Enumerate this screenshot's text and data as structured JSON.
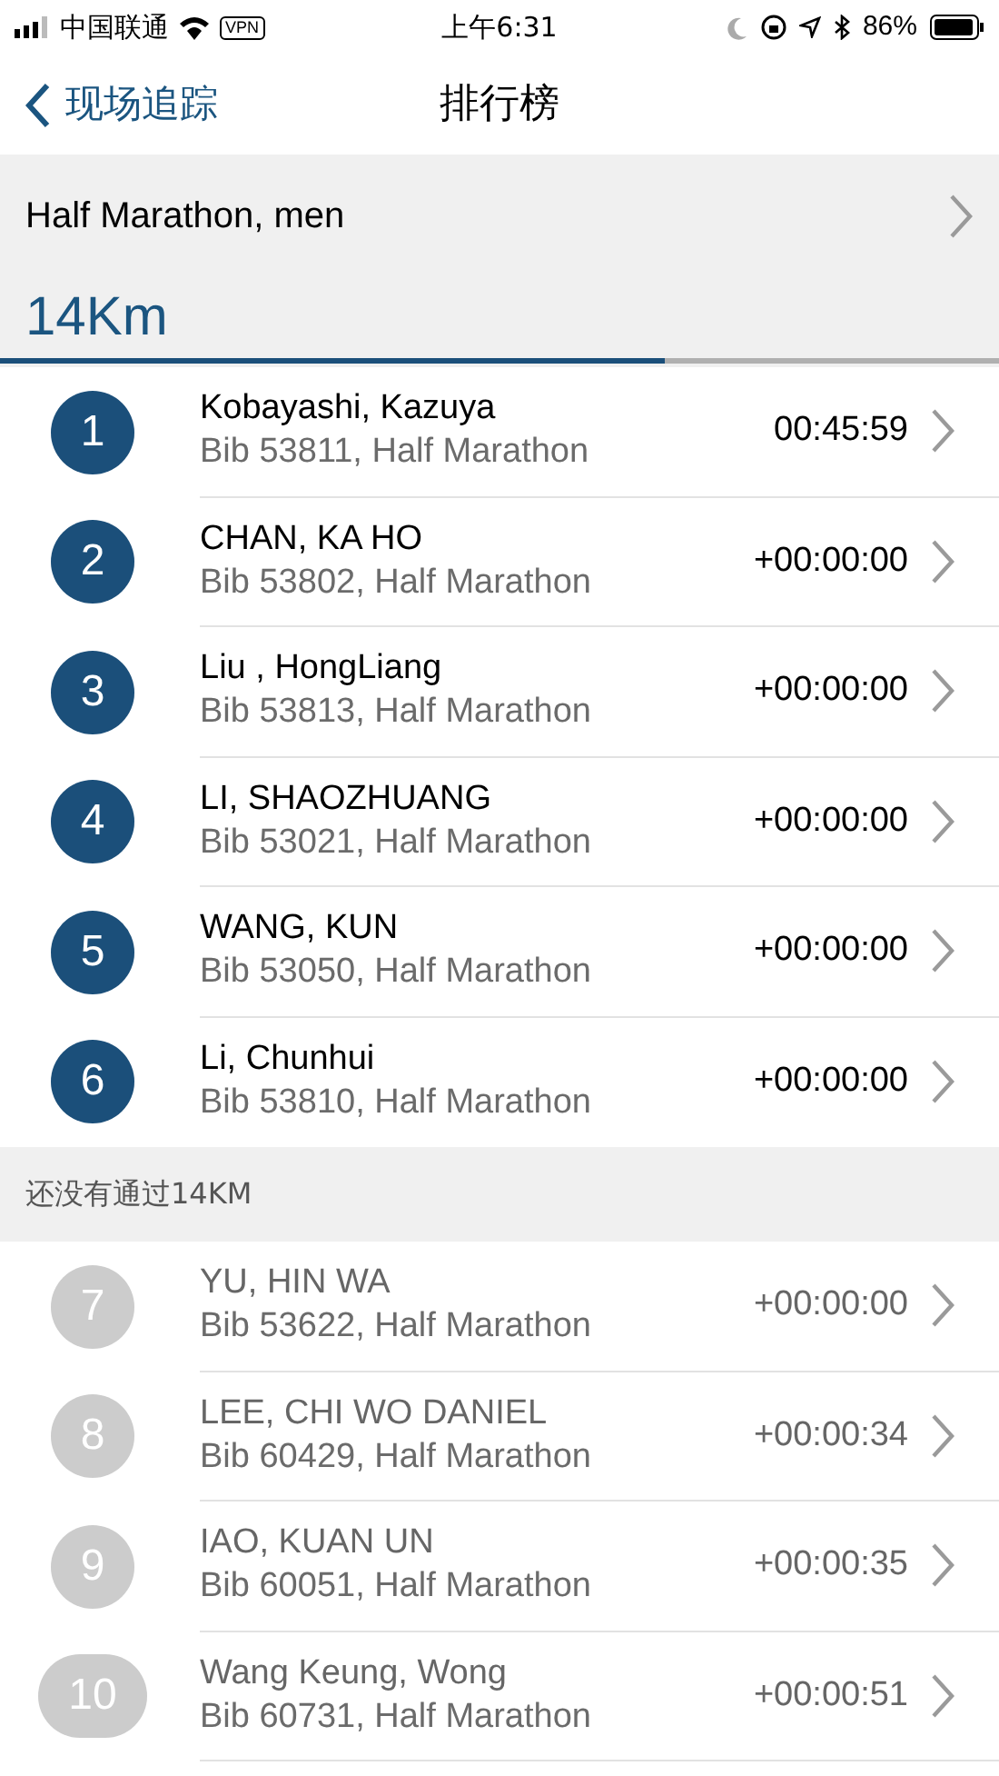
{
  "status_bar": {
    "carrier": "中国联通",
    "vpn": "VPN",
    "time": "上午6:31",
    "battery": "86%"
  },
  "nav": {
    "back": "现场追踪",
    "title": "排行榜"
  },
  "category": {
    "label": "Half Marathon, men"
  },
  "split": {
    "label": "14Km",
    "level": 0.665
  },
  "runners": [
    {
      "rank": "1",
      "name": "Kobayashi, Kazuya",
      "detail": "Bib 53811, Half Marathon",
      "time": "00:45:59",
      "passed": true
    },
    {
      "rank": "2",
      "name": "CHAN, KA HO",
      "detail": "Bib 53802, Half Marathon",
      "time": "+00:00:00",
      "passed": true
    },
    {
      "rank": "3",
      "name": "Liu , HongLiang",
      "detail": "Bib 53813, Half Marathon",
      "time": "+00:00:00",
      "passed": true
    },
    {
      "rank": "4",
      "name": "LI, SHAOZHUANG",
      "detail": "Bib 53021, Half Marathon",
      "time": "+00:00:00",
      "passed": true
    },
    {
      "rank": "5",
      "name": "WANG, KUN",
      "detail": "Bib 53050, Half Marathon",
      "time": "+00:00:00",
      "passed": true
    },
    {
      "rank": "6",
      "name": "Li, Chunhui",
      "detail": "Bib 53810, Half Marathon",
      "time": "+00:00:00",
      "passed": true
    }
  ],
  "pending_section": {
    "title": "还没有通过14KM",
    "runners": [
      {
        "rank": "7",
        "name": "YU, HIN WA",
        "detail": "Bib 53622, Half Marathon",
        "time": "+00:00:00",
        "passed": false
      },
      {
        "rank": "8",
        "name": "LEE, CHI WO DANIEL",
        "detail": "Bib 60429, Half Marathon",
        "time": "+00:00:34",
        "passed": false
      },
      {
        "rank": "9",
        "name": "IAO, KUAN UN",
        "detail": "Bib 60051, Half Marathon",
        "time": "+00:00:35",
        "passed": false
      },
      {
        "rank": "10",
        "name": "Wang Keung, Wong",
        "detail": "Bib 60731, Half Marathon",
        "time": "+00:00:51",
        "passed": false
      }
    ]
  }
}
